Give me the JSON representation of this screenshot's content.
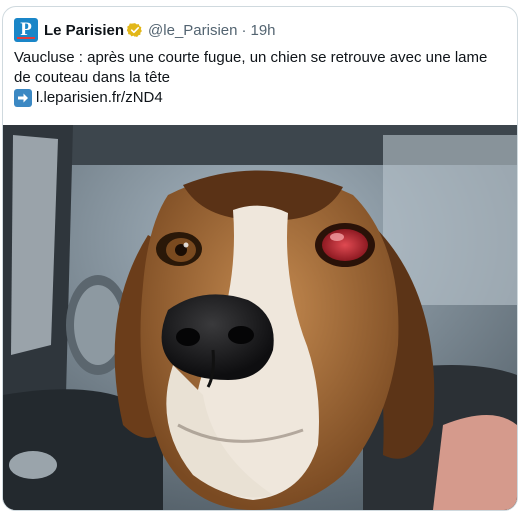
{
  "tweet": {
    "author_name": "Le Parisien",
    "handle": "@le_Parisien",
    "separator": "·",
    "time": "19h",
    "logo_letter": "P",
    "text": "Vaucluse : après une courte fugue, un chien se retrouve avec une lame de couteau dans la tête",
    "link_text": "l.leparisien.fr/zND4",
    "icons": {
      "logo": "le-parisien-logo",
      "verified": "verified-gold-badge-icon",
      "arrow": "right-arrow-emoji-icon"
    }
  },
  "colors": {
    "logo_blue": "#1a86c8",
    "verified_gold": "#e2b719",
    "text": "#0f1419",
    "secondary_text": "#536471",
    "border": "#cfd9de"
  }
}
